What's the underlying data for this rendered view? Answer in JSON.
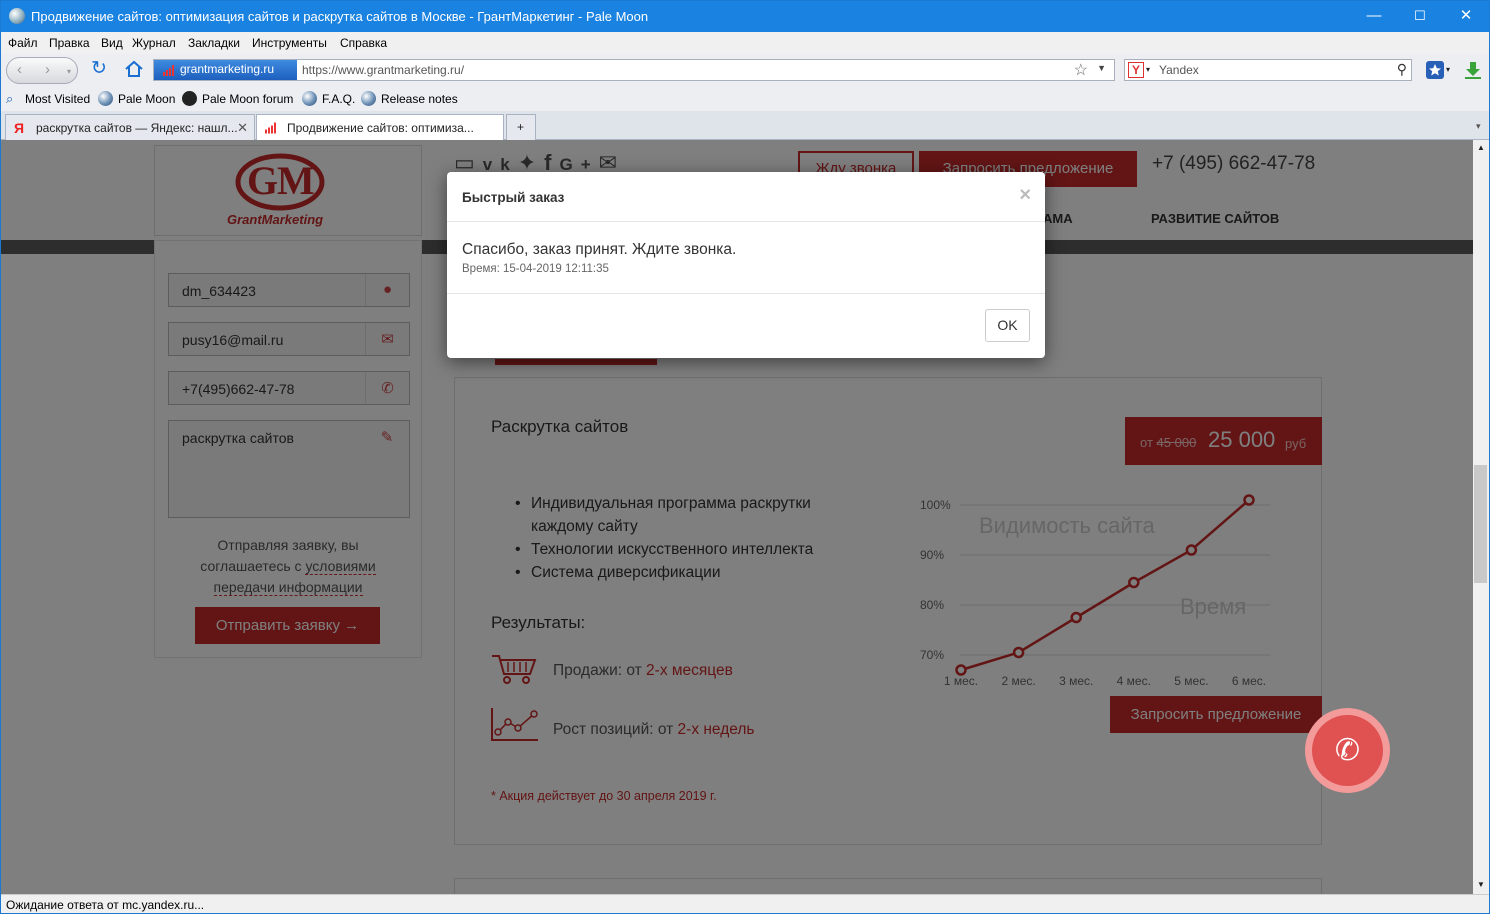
{
  "window": {
    "title": "Продвижение сайтов: оптимизация сайтов и раскрутка сайтов в Москве - ГрантМаркетинг - Pale Moon",
    "minimize": "—",
    "maximize": "☐",
    "close": "✕"
  },
  "menu": [
    "Файл",
    "Правка",
    "Вид",
    "Журнал",
    "Закладки",
    "Инструменты",
    "Справка"
  ],
  "nav": {
    "site_badge": "grantmarketing.ru",
    "url": "https://www.grantmarketing.ru/",
    "search_placeholder": "Yandex",
    "yandex_letter": "Y"
  },
  "bookmarks": [
    "Most Visited",
    "Pale Moon",
    "Pale Moon forum",
    "F.A.Q.",
    "Release notes"
  ],
  "tabs": [
    {
      "label": "раскрутка сайтов — Яндекс: нашл...",
      "favicon": "Я"
    },
    {
      "label": "Продвижение сайтов: оптимиза...",
      "favicon": "bars"
    }
  ],
  "new_tab": "+",
  "status": "Ожидание ответа от mc.yandex.ru...",
  "page": {
    "logo_text": "GrantMarketing",
    "form": {
      "name_value": "dm_634423",
      "email_value": "pusy16@mail.ru",
      "phone_value": "+7(495)662-47-78",
      "message_value": "раскрутка сайтов",
      "agree_prefix": "Отправляя заявку, вы соглашаетесь с",
      "agree_link": "условиями передачи информации",
      "submit": "Отправить заявку →"
    },
    "header": {
      "callback_btn": "Жду звонка",
      "request_btn": "Запросить предложение",
      "phone": "+7 (495) 662-47-78",
      "menu_partial": "АМА",
      "menu_item": "РАЗВИТИЕ САЙТОВ"
    },
    "offer": {
      "title": "Раскрутка сайтов",
      "price_prefix": "от",
      "price_old": "45 000",
      "price_new": "25 000",
      "price_currency": "руб",
      "features": [
        "Индивидуальная программа раскрутки каждому сайту",
        "Технологии искусственного интеллекта",
        "Система диверсификации"
      ],
      "results_title": "Результаты:",
      "sales_label": "Продажи: от ",
      "sales_value": "2-х месяцев",
      "growth_label": "Рост позиций: от ",
      "growth_value": "2-х недель",
      "note": "* Акция действует до 30 апреля 2019 г.",
      "request_btn": "Запросить предложение"
    },
    "chart_data": {
      "type": "line",
      "title": "Видимость сайта",
      "xlabel": "Время",
      "ylabel": "",
      "categories": [
        "1 мес.",
        "2 мес.",
        "3 мес.",
        "4 мес.",
        "5 мес.",
        "6 мес."
      ],
      "y_ticks": [
        "100%",
        "90%",
        "80%",
        "70%"
      ],
      "values": [
        67,
        70.5,
        77.5,
        84.5,
        91,
        101
      ],
      "ylim": [
        67,
        103
      ],
      "color": "#c62a2a"
    }
  },
  "modal": {
    "title": "Быстрый заказ",
    "close": "×",
    "message": "Спасибо, заказ принят. Ждите звонка.",
    "time": "Время: 15-04-2019 12:11:35",
    "ok": "OK"
  },
  "colors": {
    "accent": "#c62a2a",
    "titlebar": "#1a82e0"
  }
}
